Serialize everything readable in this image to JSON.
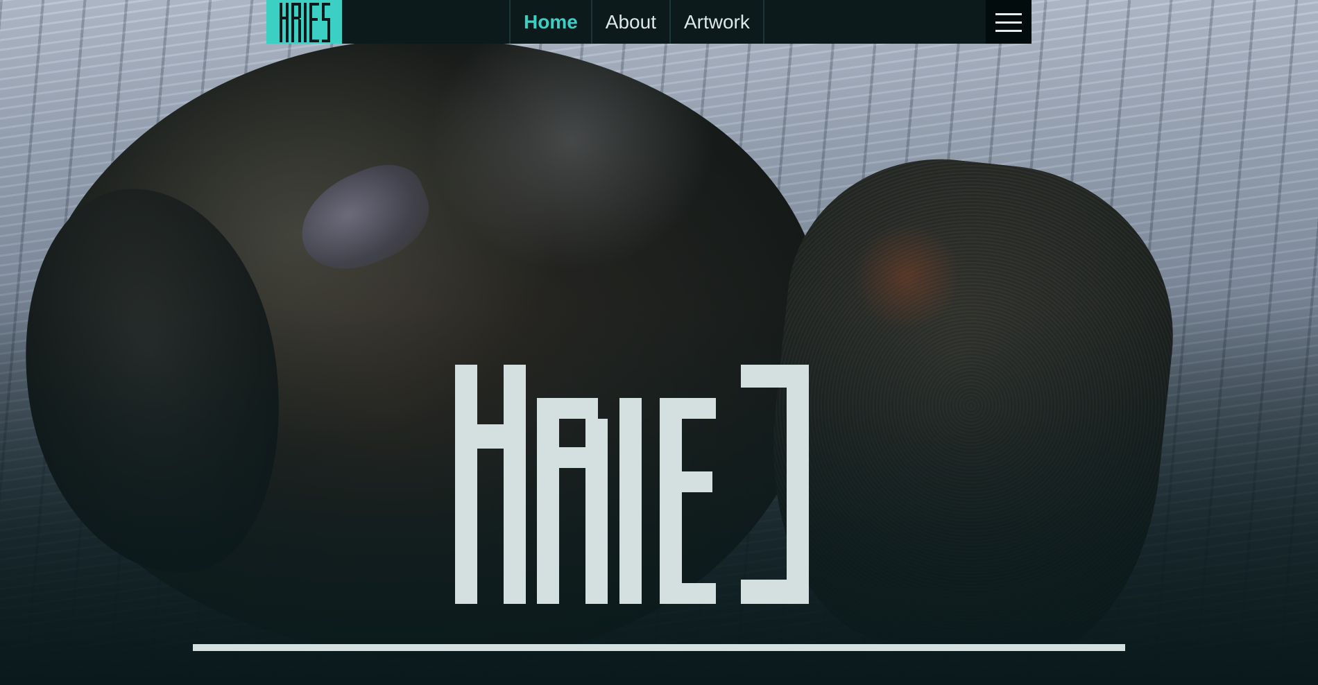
{
  "brand": {
    "name": "KRIES",
    "accent_color": "#3ccfc4",
    "logo_text_color": "#0c1a1c"
  },
  "navbar": {
    "background": "#0c1a1c",
    "links": [
      {
        "label": "Home",
        "active": true
      },
      {
        "label": "About",
        "active": false
      },
      {
        "label": "Artwork",
        "active": false
      }
    ],
    "menu_icon": "hamburger-menu-icon"
  },
  "hero": {
    "wordmark": "KRIES",
    "wordmark_color": "#d4e0e0",
    "divider_color": "#d4e0e0",
    "background_description_icon": "sculpture-photo"
  }
}
